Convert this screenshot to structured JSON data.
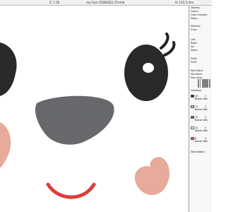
{
  "topbar": {
    "zoom_label": "Z: 1.26",
    "filename": "my Face 25082022.2T.emb",
    "dims": "H: 115.5 mm"
  },
  "info": {
    "stitches": "Stitches:",
    "colors": "Colors:",
    "color_changes": "Color changes:",
    "stops": "Stops:",
    "machine": "Machine:",
    "trims": "Trims:",
    "left": "Left:",
    "right": "Right:",
    "up": "Up:",
    "down": "Down:",
    "endx": "EndX:",
    "endy": "EndY:",
    "max_stitch": "Max Stitch:",
    "min_stitch": "Min Stitch:",
    "max_jump": "Max Jump:",
    "colorway": "Colorway:",
    "total_bobbin": "Total Bobbin:"
  },
  "threads": [
    {
      "index": "1",
      "code": "10",
      "count": "1",
      "brand": "Brand: Wilc",
      "color": "#2b2b2b"
    },
    {
      "index": "2",
      "code": "11",
      "count": "2",
      "brand": "Brand: Wilc",
      "color": "#e8b2a6"
    },
    {
      "index": "3",
      "code": "13",
      "count": "3",
      "brand": "Brand: Wilc",
      "color": "#6b6b6b"
    },
    {
      "index": "4",
      "code": "14",
      "count": "4",
      "brand": "Brand: Wilc",
      "color": "#ffffff"
    },
    {
      "index": "5",
      "code": "6",
      "count": "5",
      "brand": "Brand: Wilc",
      "color": "#e05050"
    }
  ],
  "colors": {
    "eye": "#232323",
    "eye_shine": "#ffffff",
    "nose": "#5b5d60",
    "cheek": "#e7aa9b",
    "mouth": "#e03b3b"
  }
}
